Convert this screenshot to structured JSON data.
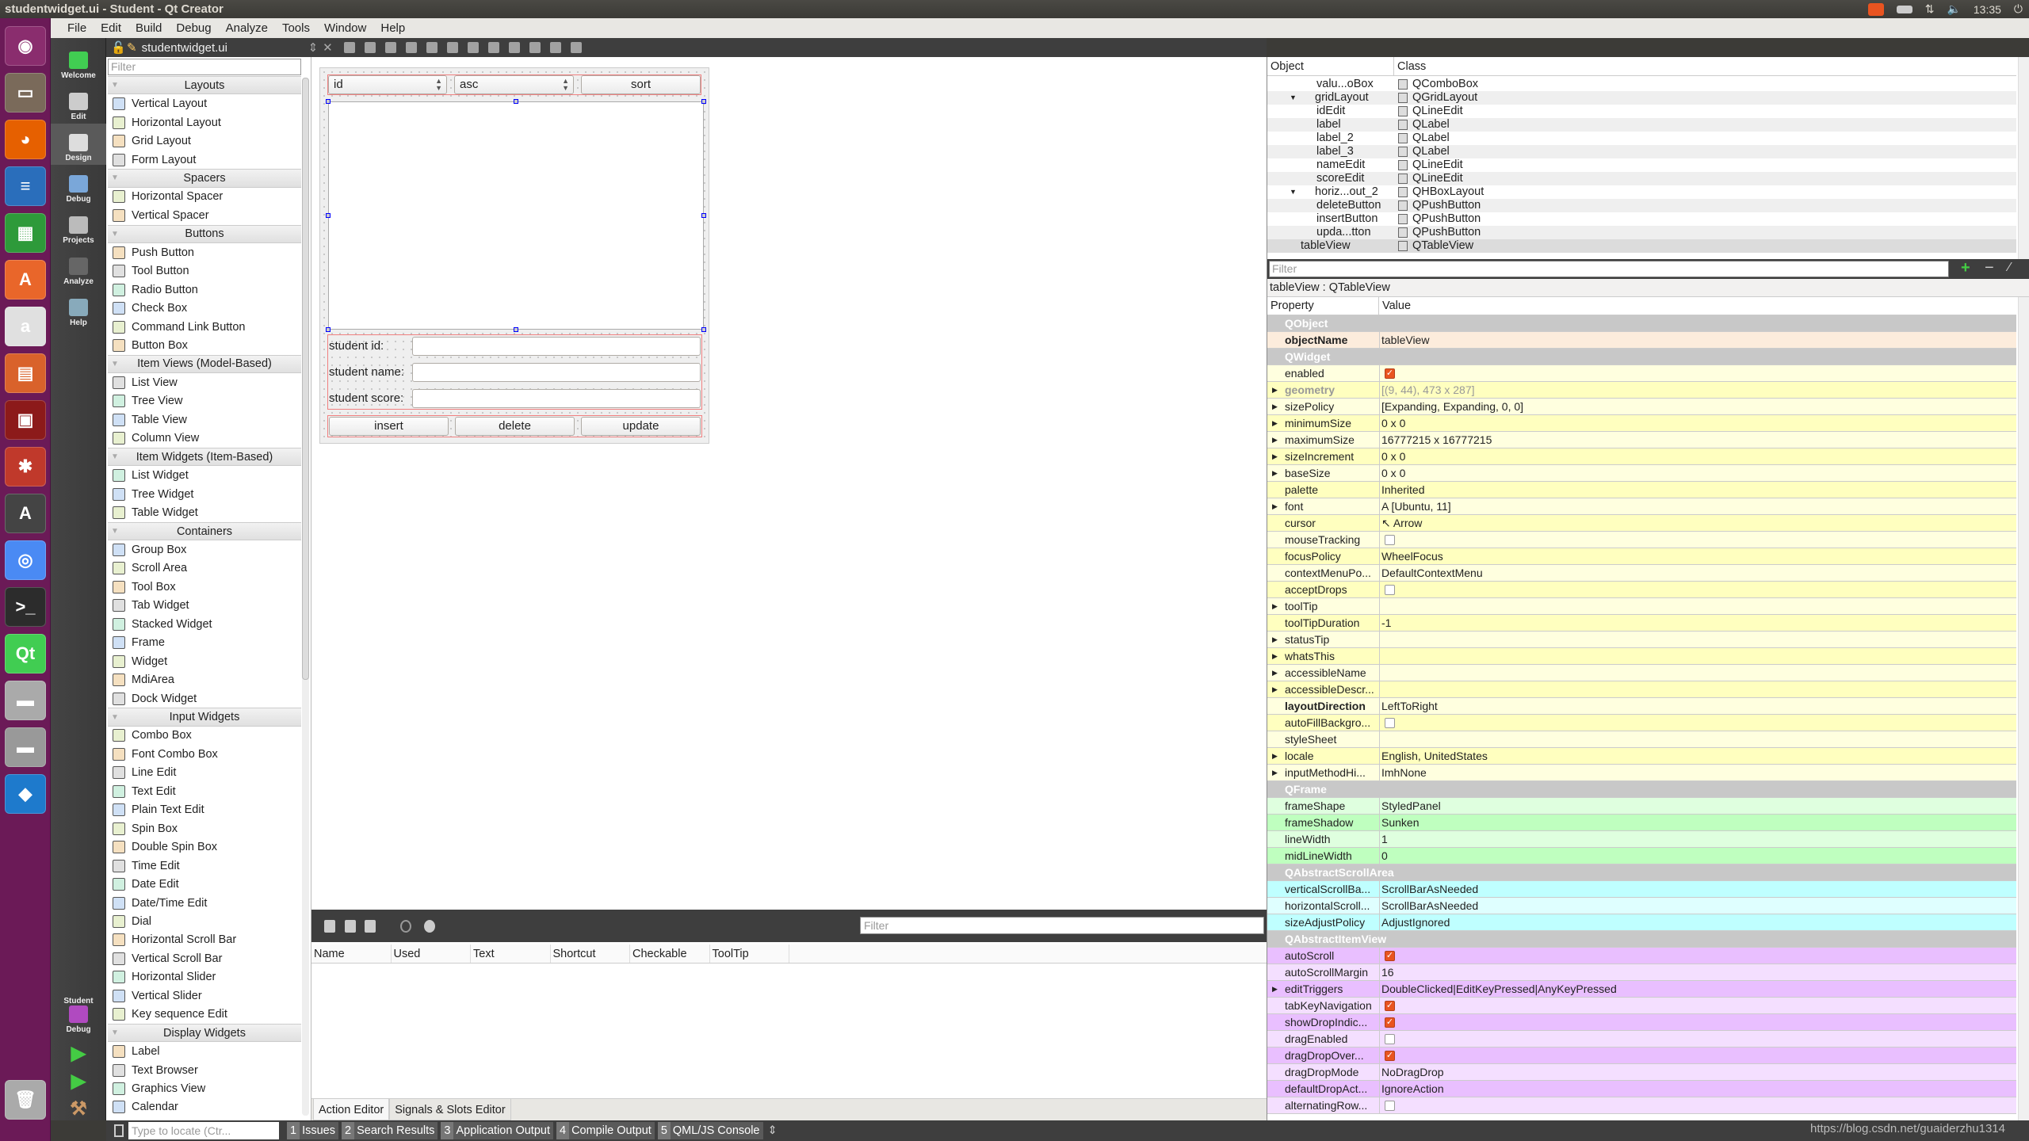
{
  "window": {
    "title": "studentwidget.ui - Student - Qt Creator",
    "clock": "13:35"
  },
  "tray_icons": [
    "qt-update-icon",
    "keyboard-icon",
    "network-icon",
    "volume-icon",
    "power-icon"
  ],
  "menu": [
    "File",
    "Edit",
    "Build",
    "Debug",
    "Analyze",
    "Tools",
    "Window",
    "Help"
  ],
  "launcher": [
    {
      "icon": "ubuntu-dash-icon",
      "glyph": "◉",
      "color": "#8a2d6e"
    },
    {
      "icon": "files-icon",
      "glyph": "▭",
      "color": "#7a6a5a"
    },
    {
      "icon": "firefox-icon",
      "glyph": "◕",
      "color": "#e66000"
    },
    {
      "icon": "writer-icon",
      "glyph": "≡",
      "color": "#2a6ebb"
    },
    {
      "icon": "calc-icon",
      "glyph": "▦",
      "color": "#2e9a3a"
    },
    {
      "icon": "software-center-icon",
      "glyph": "A",
      "color": "#e9662a"
    },
    {
      "icon": "amazon-icon",
      "glyph": "a",
      "color": "#e0e0e0"
    },
    {
      "icon": "impress-icon",
      "glyph": "▤",
      "color": "#d9622b"
    },
    {
      "icon": "red-app-icon",
      "glyph": "▣",
      "color": "#8c1a1a"
    },
    {
      "icon": "settings-icon",
      "glyph": "✱",
      "color": "#c0392b"
    },
    {
      "icon": "software-updater-icon",
      "glyph": "A",
      "color": "#444"
    },
    {
      "icon": "chrome-icon",
      "glyph": "◎",
      "color": "#4a8af4"
    },
    {
      "icon": "terminal-icon",
      "glyph": ">_",
      "color": "#2c2c2c"
    },
    {
      "icon": "qt-creator-icon",
      "glyph": "Qt",
      "color": "#41cd52"
    },
    {
      "icon": "disk-icon",
      "glyph": "▬",
      "color": "#aaa"
    },
    {
      "icon": "disk-icon-2",
      "glyph": "▬",
      "color": "#999"
    },
    {
      "icon": "vscode-icon",
      "glyph": "◆",
      "color": "#1e7acc"
    }
  ],
  "trash_icon": "trash-icon",
  "modes": [
    {
      "label": "Welcome",
      "icon": "qt-logo-icon"
    },
    {
      "label": "Edit",
      "icon": "edit-document-icon"
    },
    {
      "label": "Design",
      "icon": "design-pen-icon",
      "active": true
    },
    {
      "label": "Debug",
      "icon": "debug-bug-icon"
    },
    {
      "label": "Projects",
      "icon": "projects-wrench-icon"
    },
    {
      "label": "Analyze",
      "icon": "analyze-icon"
    },
    {
      "label": "Help",
      "icon": "help-icon"
    }
  ],
  "kit": {
    "project": "Student",
    "build": "Debug"
  },
  "doc": {
    "filename": "studentwidget.ui"
  },
  "widget_box": {
    "filter_placeholder": "Filter",
    "categories": [
      {
        "name": "Layouts",
        "items": [
          "Vertical Layout",
          "Horizontal Layout",
          "Grid Layout",
          "Form Layout"
        ]
      },
      {
        "name": "Spacers",
        "items": [
          "Horizontal Spacer",
          "Vertical Spacer"
        ]
      },
      {
        "name": "Buttons",
        "items": [
          "Push Button",
          "Tool Button",
          "Radio Button",
          "Check Box",
          "Command Link Button",
          "Button Box"
        ]
      },
      {
        "name": "Item Views (Model-Based)",
        "items": [
          "List View",
          "Tree View",
          "Table View",
          "Column View"
        ]
      },
      {
        "name": "Item Widgets (Item-Based)",
        "items": [
          "List Widget",
          "Tree Widget",
          "Table Widget"
        ]
      },
      {
        "name": "Containers",
        "items": [
          "Group Box",
          "Scroll Area",
          "Tool Box",
          "Tab Widget",
          "Stacked Widget",
          "Frame",
          "Widget",
          "MdiArea",
          "Dock Widget"
        ]
      },
      {
        "name": "Input Widgets",
        "items": [
          "Combo Box",
          "Font Combo Box",
          "Line Edit",
          "Text Edit",
          "Plain Text Edit",
          "Spin Box",
          "Double Spin Box",
          "Time Edit",
          "Date Edit",
          "Date/Time Edit",
          "Dial",
          "Horizontal Scroll Bar",
          "Vertical Scroll Bar",
          "Horizontal Slider",
          "Vertical Slider",
          "Key sequence Edit"
        ]
      },
      {
        "name": "Display Widgets",
        "items": [
          "Label",
          "Text Browser",
          "Graphics View",
          "Calendar"
        ]
      }
    ]
  },
  "form": {
    "sort_field": "id",
    "sort_order": "asc",
    "sort_button": "sort",
    "labels": [
      "student id:",
      "student name:",
      "student score:"
    ],
    "buttons": [
      "insert",
      "delete",
      "update"
    ]
  },
  "action_editor": {
    "filter_placeholder": "Filter",
    "columns": [
      "Name",
      "Used",
      "Text",
      "Shortcut",
      "Checkable",
      "ToolTip"
    ],
    "tabs": [
      "Action Editor",
      "Signals & Slots Editor"
    ],
    "tool_icons": [
      "new-action-icon",
      "copy-icon",
      "paste-icon",
      "delete-icon",
      "settings-gear-icon"
    ]
  },
  "object_inspector": {
    "columns": [
      "Object",
      "Class"
    ],
    "rows": [
      {
        "name": "valu...oBox",
        "class": "QComboBox",
        "indent": 2
      },
      {
        "name": "gridLayout",
        "class": "QGridLayout",
        "indent": 1,
        "expanded": true
      },
      {
        "name": "idEdit",
        "class": "QLineEdit",
        "indent": 2
      },
      {
        "name": "label",
        "class": "QLabel",
        "indent": 2
      },
      {
        "name": "label_2",
        "class": "QLabel",
        "indent": 2
      },
      {
        "name": "label_3",
        "class": "QLabel",
        "indent": 2
      },
      {
        "name": "nameEdit",
        "class": "QLineEdit",
        "indent": 2
      },
      {
        "name": "scoreEdit",
        "class": "QLineEdit",
        "indent": 2
      },
      {
        "name": "horiz...out_2",
        "class": "QHBoxLayout",
        "indent": 1,
        "expanded": true
      },
      {
        "name": "deleteButton",
        "class": "QPushButton",
        "indent": 2
      },
      {
        "name": "insertButton",
        "class": "QPushButton",
        "indent": 2
      },
      {
        "name": "upda...tton",
        "class": "QPushButton",
        "indent": 2
      },
      {
        "name": "tableView",
        "class": "QTableView",
        "indent": 0,
        "selected": true
      }
    ]
  },
  "property_editor": {
    "filter_placeholder": "Filter",
    "current": "tableView : QTableView",
    "columns": [
      "Property",
      "Value"
    ],
    "group_colors": {
      "QObject": [
        "#fcecdc",
        "#fcecdc"
      ],
      "QWidget": [
        "#ffffdf",
        "#ffffbf"
      ],
      "QFrame": [
        "#dfffdf",
        "#bfffbf"
      ],
      "QAbstractScrollArea": [
        "#bfffff",
        "#dfffff"
      ],
      "QAbstractItemView": [
        "#e9bfff",
        "#f4dfff"
      ]
    },
    "groups": [
      {
        "name": "QObject",
        "rows": [
          {
            "name": "objectName",
            "value": "tableView",
            "bold": true
          }
        ]
      },
      {
        "name": "QWidget",
        "rows": [
          {
            "name": "enabled",
            "check": true
          },
          {
            "name": "geometry",
            "value": "[(9, 44), 473 x 287]",
            "expand": true,
            "disabled": true
          },
          {
            "name": "sizePolicy",
            "value": "[Expanding, Expanding, 0, 0]",
            "expand": true
          },
          {
            "name": "minimumSize",
            "value": "0 x 0",
            "expand": true
          },
          {
            "name": "maximumSize",
            "value": "16777215 x 16777215",
            "expand": true
          },
          {
            "name": "sizeIncrement",
            "value": "0 x 0",
            "expand": true
          },
          {
            "name": "baseSize",
            "value": "0 x 0",
            "expand": true
          },
          {
            "name": "palette",
            "value": "Inherited"
          },
          {
            "name": "font",
            "value": "A  [Ubuntu, 11]",
            "expand": true
          },
          {
            "name": "cursor",
            "value": "↖  Arrow"
          },
          {
            "name": "mouseTracking",
            "check": false
          },
          {
            "name": "focusPolicy",
            "value": "WheelFocus"
          },
          {
            "name": "contextMenuPo...",
            "value": "DefaultContextMenu"
          },
          {
            "name": "acceptDrops",
            "check": false
          },
          {
            "name": "toolTip",
            "value": "",
            "expand": true
          },
          {
            "name": "toolTipDuration",
            "value": "-1"
          },
          {
            "name": "statusTip",
            "value": "",
            "expand": true
          },
          {
            "name": "whatsThis",
            "value": "",
            "expand": true
          },
          {
            "name": "accessibleName",
            "value": "",
            "expand": true
          },
          {
            "name": "accessibleDescr...",
            "value": "",
            "expand": true
          },
          {
            "name": "layoutDirection",
            "value": "LeftToRight",
            "bold": true
          },
          {
            "name": "autoFillBackgro...",
            "check": false
          },
          {
            "name": "styleSheet",
            "value": ""
          },
          {
            "name": "locale",
            "value": "English, UnitedStates",
            "expand": true
          },
          {
            "name": "inputMethodHi...",
            "value": "ImhNone",
            "expand": true
          }
        ]
      },
      {
        "name": "QFrame",
        "rows": [
          {
            "name": "frameShape",
            "value": "StyledPanel"
          },
          {
            "name": "frameShadow",
            "value": "Sunken"
          },
          {
            "name": "lineWidth",
            "value": "1"
          },
          {
            "name": "midLineWidth",
            "value": "0"
          }
        ]
      },
      {
        "name": "QAbstractScrollArea",
        "rows": [
          {
            "name": "verticalScrollBa...",
            "value": "ScrollBarAsNeeded"
          },
          {
            "name": "horizontalScroll...",
            "value": "ScrollBarAsNeeded"
          },
          {
            "name": "sizeAdjustPolicy",
            "value": "AdjustIgnored"
          }
        ]
      },
      {
        "name": "QAbstractItemView",
        "rows": [
          {
            "name": "autoScroll",
            "check": true
          },
          {
            "name": "autoScrollMargin",
            "value": "16"
          },
          {
            "name": "editTriggers",
            "value": "DoubleClicked|EditKeyPressed|AnyKeyPressed",
            "expand": true
          },
          {
            "name": "tabKeyNavigation",
            "check": true
          },
          {
            "name": "showDropIndic...",
            "check": true
          },
          {
            "name": "dragEnabled",
            "check": false
          },
          {
            "name": "dragDropOver...",
            "check": true
          },
          {
            "name": "dragDropMode",
            "value": "NoDragDrop"
          },
          {
            "name": "defaultDropAct...",
            "value": "IgnoreAction"
          },
          {
            "name": "alternatingRow...",
            "check": false
          }
        ]
      }
    ]
  },
  "statusbar": {
    "locate_placeholder": "Type to locate (Ctr...",
    "tabs": [
      {
        "n": "1",
        "label": "Issues"
      },
      {
        "n": "2",
        "label": "Search Results"
      },
      {
        "n": "3",
        "label": "Application Output"
      },
      {
        "n": "4",
        "label": "Compile Output"
      },
      {
        "n": "5",
        "label": "QML/JS Console"
      }
    ],
    "watermark": "https://blog.csdn.net/guaiderzhu1314"
  }
}
